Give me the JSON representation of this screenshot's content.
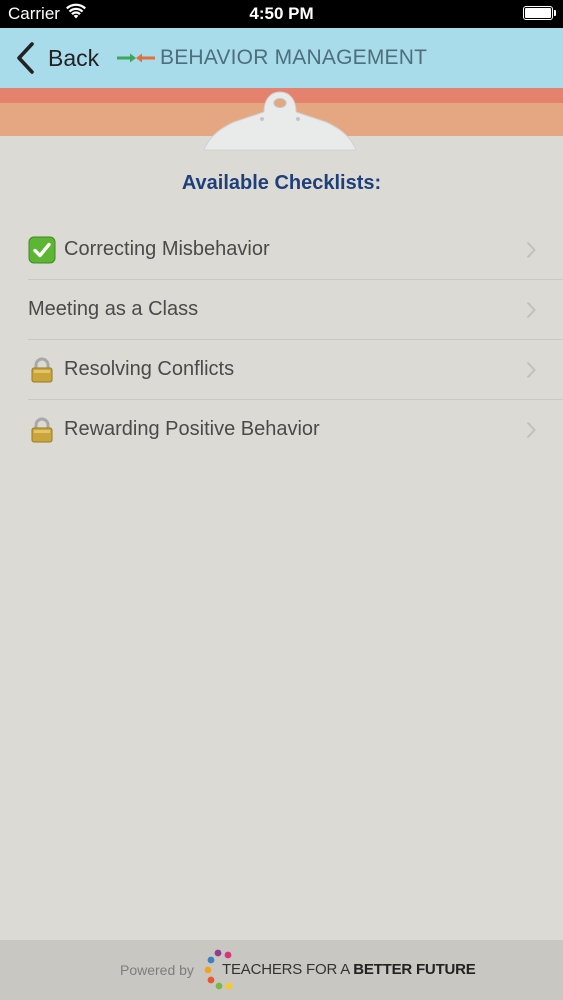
{
  "status_bar": {
    "carrier": "Carrier",
    "time": "4:50 PM",
    "icons": [
      "wifi-icon",
      "battery-icon"
    ]
  },
  "nav_bar": {
    "back_label": "Back",
    "title": "BEHAVIOR MANAGEMENT",
    "colors": {
      "background": "#a9dceb",
      "title": "#4d6e7a"
    }
  },
  "header_colors": {
    "stripe_top": "#e4826e",
    "stripe_bottom": "#e5a782"
  },
  "content": {
    "title": "Available Checklists:",
    "title_color": "#1f3f7a",
    "items": [
      {
        "label": "Correcting Misbehavior",
        "icon": "check-mark-icon",
        "status": "completed"
      },
      {
        "label": "Meeting as a Class",
        "icon": null,
        "status": "available"
      },
      {
        "label": "Resolving Conflicts",
        "icon": "lock-icon",
        "status": "locked"
      },
      {
        "label": "Rewarding Positive Behavior",
        "icon": "lock-icon",
        "status": "locked"
      }
    ]
  },
  "footer": {
    "powered_by": "Powered by",
    "org_name_part1": "TEACHERS FOR A ",
    "org_name_part2": "BETTER FUTURE"
  }
}
